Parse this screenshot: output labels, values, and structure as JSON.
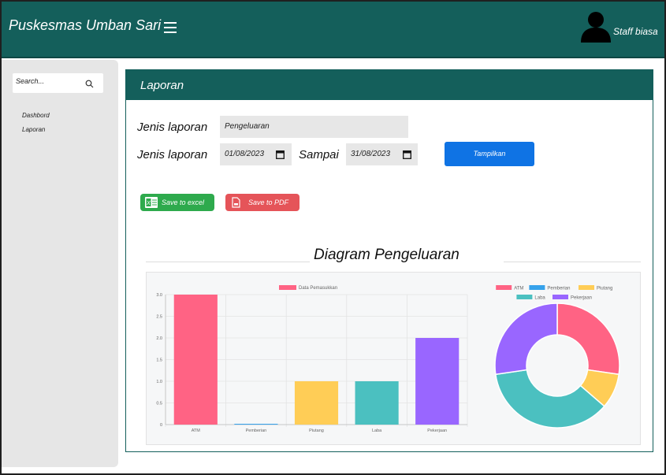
{
  "app": {
    "title": "Puskesmas Umban Sari",
    "user": "Staff biasa"
  },
  "sidebar": {
    "search_placeholder": "Search...",
    "items": [
      {
        "label": "Dashbord"
      },
      {
        "label": "Laporan"
      }
    ]
  },
  "panel": {
    "title": "Laporan",
    "form": {
      "jenis_label": "Jenis laporan",
      "jenis_value": "Pengeluaran",
      "periode_label": "Jenis laporan",
      "start_date": "01/08/2023",
      "sampai_label": "Sampai",
      "end_date": "31/08/2023",
      "show_button": "Tampilkan"
    },
    "export": {
      "excel": "Save to excel",
      "pdf": "Save to PDF"
    },
    "diagram_title": "Diagram Pengeluaran"
  },
  "colors": {
    "header": "#145f5b",
    "button_primary": "#0f73e4",
    "excel": "#2eaa4d",
    "pdf": "#e55459"
  },
  "chart_data": [
    {
      "type": "bar",
      "categories": [
        "ATM",
        "Pemberian",
        "Piutang",
        "Laba",
        "Pekerjaan"
      ],
      "series": [
        {
          "name": "Data Pemasukkan",
          "values": [
            3.0,
            0,
            1.0,
            1.0,
            2.0
          ]
        }
      ],
      "bar_colors": [
        "#ff6384",
        "#36a2eb",
        "#ffcd56",
        "#4bc0c0",
        "#9966ff"
      ],
      "yticks": [
        "3.0",
        "2.5",
        "2.0",
        "1.5",
        "1.0",
        "0.5",
        "0"
      ],
      "ylim": [
        0,
        3
      ],
      "grid": true,
      "legend_position": "top"
    },
    {
      "type": "pie",
      "donut": true,
      "labels": [
        "ATM",
        "Pemberian",
        "Piutang",
        "Laba",
        "Pekerjaan"
      ],
      "values": [
        3,
        0,
        1,
        4,
        3
      ],
      "colors": [
        "#ff6384",
        "#36a2eb",
        "#ffcd56",
        "#4bc0c0",
        "#9966ff"
      ],
      "legend_position": "top"
    }
  ]
}
